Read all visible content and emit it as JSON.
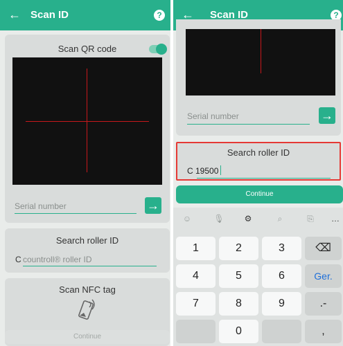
{
  "left_screen": {
    "header": {
      "back_icon": "←",
      "title": "Scan ID",
      "help_icon": "?"
    },
    "qr_card": {
      "title": "Scan QR code",
      "toggle_on": true
    },
    "serial": {
      "placeholder": "Serial number",
      "go_icon": "→"
    },
    "roller_card": {
      "title": "Search roller ID",
      "prefix": "C",
      "placeholder": "countroll® roller ID"
    },
    "nfc_card": {
      "title": "Scan NFC tag",
      "icon": "nfc-phone-icon"
    },
    "continue_label": "Continue"
  },
  "right_screen": {
    "header": {
      "back_icon": "←",
      "title": "Scan ID",
      "help_icon": "?"
    },
    "serial": {
      "placeholder": "Serial number",
      "go_icon": "→"
    },
    "roller_card": {
      "title": "Search roller ID",
      "value": "C 19500"
    },
    "continue_label": "Continue",
    "keyboard": {
      "toolbar": [
        "☺",
        "🎙",
        "⚙",
        "⌕",
        "⎘",
        "…"
      ],
      "keys": [
        "1",
        "2",
        "3",
        "⌫",
        "4",
        "5",
        "6",
        "Ger.",
        "7",
        "8",
        "9",
        ".-",
        "0",
        ","
      ]
    }
  },
  "colors": {
    "accent": "#28b08c",
    "highlight_border": "#e53935",
    "enter_key": "#1e6fd9"
  }
}
